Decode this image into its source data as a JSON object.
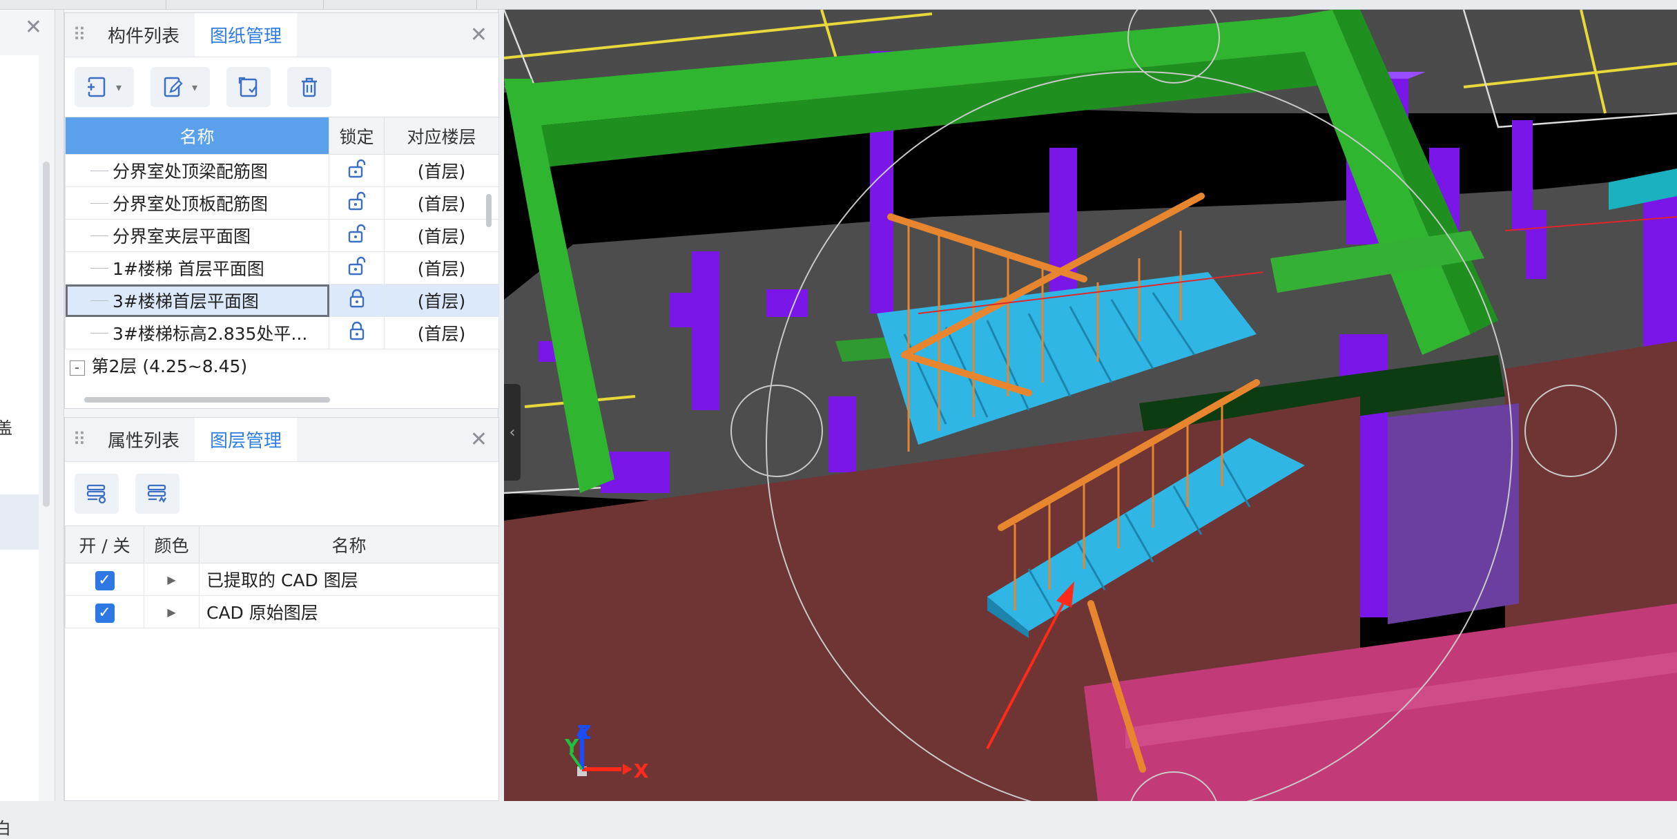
{
  "left_panel": {
    "close_glyph": "✕",
    "partial_chars": [
      "盖",
      "白"
    ]
  },
  "drawing_panel": {
    "tabs": [
      {
        "label": "构件列表",
        "active": false
      },
      {
        "label": "图纸管理",
        "active": true
      }
    ],
    "close_glyph": "✕",
    "toolbar": [
      {
        "icon": "add-drawing-icon",
        "has_dropdown": true
      },
      {
        "icon": "edit-drawing-icon",
        "has_dropdown": true
      },
      {
        "icon": "copy-drawing-icon",
        "has_dropdown": false
      },
      {
        "icon": "delete-icon",
        "has_dropdown": false
      }
    ],
    "columns": [
      "名称",
      "锁定",
      "对应楼层"
    ],
    "rows": [
      {
        "name": "分界室处顶梁配筋图",
        "locked": false,
        "floor": "(首层)",
        "selected": false
      },
      {
        "name": "分界室处顶板配筋图",
        "locked": false,
        "floor": "(首层)",
        "selected": false
      },
      {
        "name": "分界室夹层平面图",
        "locked": false,
        "floor": "(首层)",
        "selected": false
      },
      {
        "name": "1#楼梯 首层平面图",
        "locked": false,
        "floor": "(首层)",
        "selected": false
      },
      {
        "name": "3#楼梯首层平面图",
        "locked": true,
        "floor": "(首层)",
        "selected": true
      },
      {
        "name": "3#楼梯标高2.835处平...",
        "locked": true,
        "floor": "(首层)",
        "selected": false
      }
    ],
    "floor_group": {
      "expander": "-",
      "label": "第2层 (4.25~8.45)"
    }
  },
  "layer_panel": {
    "tabs": [
      {
        "label": "属性列表",
        "active": false
      },
      {
        "label": "图层管理",
        "active": true
      }
    ],
    "close_glyph": "✕",
    "toolbar": [
      {
        "icon": "show-layers-icon"
      },
      {
        "icon": "layer-settings-icon"
      }
    ],
    "columns": [
      "开 / 关",
      "颜色",
      "名称"
    ],
    "rows": [
      {
        "checked": true,
        "name": "已提取的 CAD 图层"
      },
      {
        "checked": true,
        "name": "CAD 原始图层"
      }
    ]
  },
  "viewport": {
    "axis_labels": {
      "x": "X",
      "y": "Y",
      "z": "Z"
    },
    "collapse_glyph": "‹",
    "colors": {
      "background": "#000000",
      "beam_green": "#2fb52f",
      "column_purple": "#7a16e8",
      "stair_blue": "#2fb6e4",
      "railing_orange": "#e8862f",
      "wall_brown": "#6e3534",
      "floor_pink": "#c23a78",
      "annotation_arrow": "#ff2a1a"
    }
  }
}
